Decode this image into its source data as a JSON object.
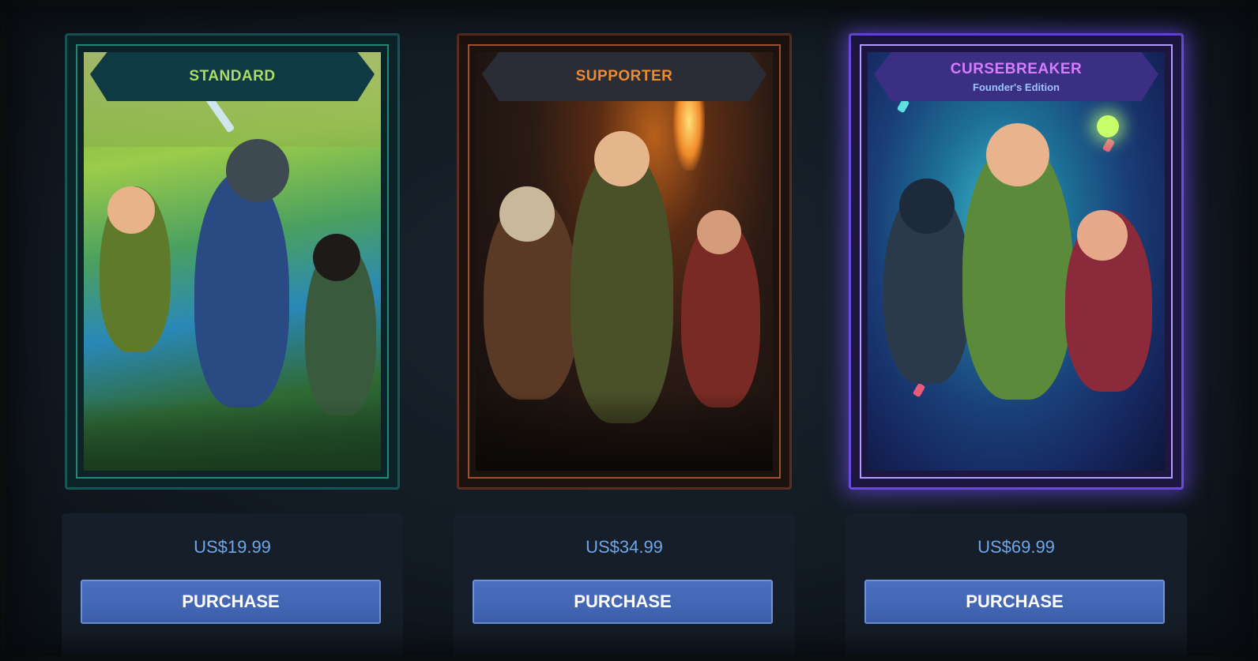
{
  "tiers": [
    {
      "id": "standard",
      "name": "STANDARD",
      "subtitle": "",
      "price": "US$19.99",
      "button_label": "PURCHASE",
      "accent": "#a9dc6a"
    },
    {
      "id": "supporter",
      "name": "SUPPORTER",
      "subtitle": "",
      "price": "US$34.99",
      "button_label": "PURCHASE",
      "accent": "#f08a2a"
    },
    {
      "id": "cursebreaker",
      "name": "CURSEBREAKER",
      "subtitle": "Founder's Edition",
      "price": "US$69.99",
      "button_label": "PURCHASE",
      "accent": "#d77cff"
    }
  ],
  "colors": {
    "background": "#0d1218",
    "panel": "#161e29",
    "price_text": "#6fa5ea",
    "button": "#4a6fbe"
  }
}
